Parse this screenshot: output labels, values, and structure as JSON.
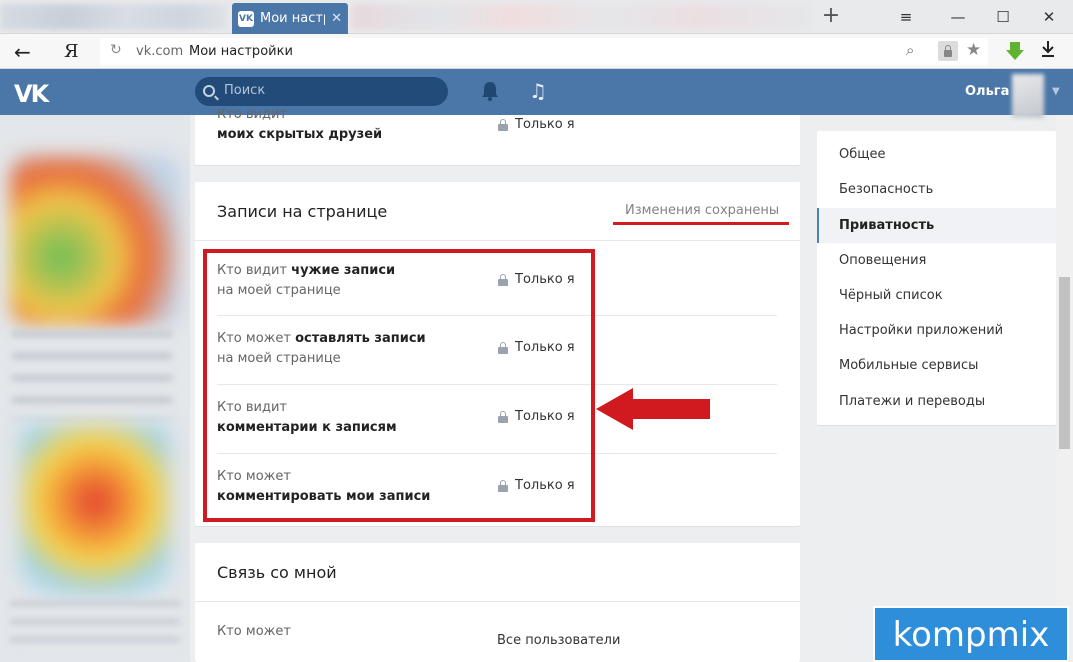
{
  "browser": {
    "tab_title": "Мои настр",
    "tab_favicon": "VK",
    "tab_close": "✕",
    "new_tab": "+",
    "minimize": "—",
    "menu": "≡",
    "maximize": "☐",
    "close": "✕",
    "back": "←",
    "ya": "Я",
    "url_host": "vk.com",
    "url_title": "Мои настройки"
  },
  "header": {
    "logo": "VK",
    "search_placeholder": "Поиск",
    "user_name": "Ольга",
    "music": "♫"
  },
  "card_hidden_friends": {
    "label_line1": "Кто видит",
    "label_line2": "моих скрытых друзей",
    "value": "Только я"
  },
  "wall": {
    "title": "Записи на странице",
    "saved_note": "Изменения сохранены",
    "rows": [
      {
        "label_prefix": "Кто видит ",
        "label_bold": "чужие записи",
        "label_line2": "на моей странице",
        "value": "Только я"
      },
      {
        "label_prefix": "Кто может ",
        "label_bold": "оставлять записи",
        "label_line2": "на моей странице",
        "value": "Только я"
      },
      {
        "label_prefix": "Кто видит",
        "label_bold": "",
        "label_line2": "комментарии к записям",
        "value": "Только я"
      },
      {
        "label_prefix": "Кто может",
        "label_bold": "",
        "label_line2": "комментировать мои записи",
        "value": "Только я"
      }
    ]
  },
  "contact": {
    "title": "Связь со мной",
    "row_label": "Кто может",
    "row_value": "Все пользователи"
  },
  "menu": {
    "items": [
      {
        "label": "Общее"
      },
      {
        "label": "Безопасность"
      },
      {
        "label": "Приватность",
        "active": true
      },
      {
        "label": "Оповещения"
      },
      {
        "label": "Чёрный список"
      },
      {
        "label": "Настройки приложений"
      },
      {
        "label": "Мобильные сервисы"
      },
      {
        "label": "Платежи и переводы"
      }
    ]
  },
  "watermark": "kompmix",
  "colors": {
    "vk_blue": "#4a76a8",
    "highlight_red": "#d01a1f"
  },
  "icons": [
    "search-icon",
    "bell-icon",
    "music-icon",
    "lock-icon",
    "star-icon",
    "download-icon",
    "back-icon",
    "reload-icon",
    "zoom-icon"
  ]
}
